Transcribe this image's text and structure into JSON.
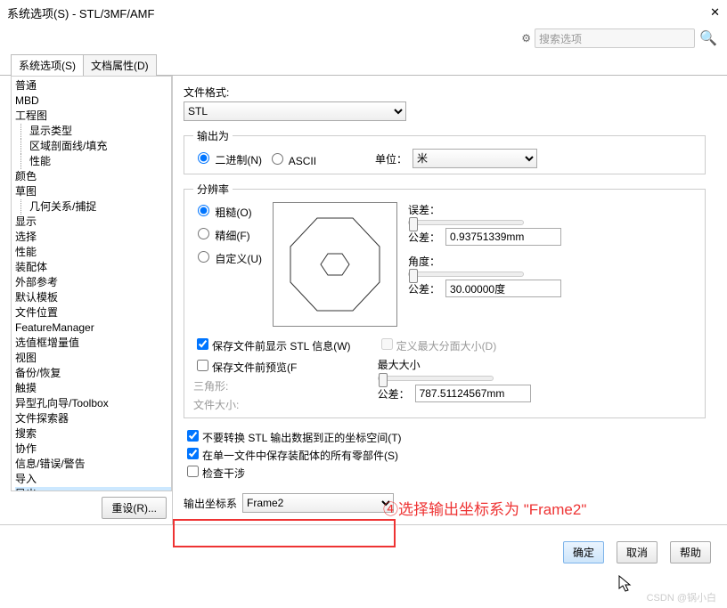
{
  "window": {
    "title": "系统选项(S) - STL/3MF/AMF"
  },
  "search": {
    "placeholder": "搜索选项"
  },
  "tabs": {
    "system": "系统选项(S)",
    "doc": "文档属性(D)"
  },
  "tree": [
    {
      "label": "普通",
      "ind": 0
    },
    {
      "label": "MBD",
      "ind": 0
    },
    {
      "label": "工程图",
      "ind": 0
    },
    {
      "label": "显示类型",
      "ind": 1
    },
    {
      "label": "区域剖面线/填充",
      "ind": 1
    },
    {
      "label": "性能",
      "ind": 1
    },
    {
      "label": "颜色",
      "ind": 0
    },
    {
      "label": "草图",
      "ind": 0
    },
    {
      "label": "几何关系/捕捉",
      "ind": 1
    },
    {
      "label": "显示",
      "ind": 0
    },
    {
      "label": "选择",
      "ind": 0
    },
    {
      "label": "性能",
      "ind": 0
    },
    {
      "label": "装配体",
      "ind": 0
    },
    {
      "label": "外部参考",
      "ind": 0
    },
    {
      "label": "默认模板",
      "ind": 0
    },
    {
      "label": "文件位置",
      "ind": 0
    },
    {
      "label": "FeatureManager",
      "ind": 0
    },
    {
      "label": "选值框增量值",
      "ind": 0
    },
    {
      "label": "视图",
      "ind": 0
    },
    {
      "label": "备份/恢复",
      "ind": 0
    },
    {
      "label": "触摸",
      "ind": 0
    },
    {
      "label": "异型孔向导/Toolbox",
      "ind": 0
    },
    {
      "label": "文件探索器",
      "ind": 0
    },
    {
      "label": "搜索",
      "ind": 0
    },
    {
      "label": "协作",
      "ind": 0
    },
    {
      "label": "信息/错误/警告",
      "ind": 0
    },
    {
      "label": "导入",
      "ind": 0
    },
    {
      "label": "导出",
      "ind": 0
    }
  ],
  "reset": "重设(R)...",
  "main": {
    "file_format_lbl": "文件格式:",
    "file_format_val": "STL",
    "output_as_lbl": "输出为",
    "binary": "二进制(N)",
    "ascii": "ASCII",
    "unit_lbl": "单位：",
    "unit_val": "米",
    "resolution_lbl": "分辨率",
    "coarse": "粗糙(O)",
    "fine": "精细(F)",
    "custom": "自定义(U)",
    "deviation_lbl": "误差：",
    "tol1_lbl": "公差：",
    "tol1_val": "0.93751339mm",
    "angle_lbl": "角度：",
    "tol2_lbl": "公差：",
    "tol2_val": "30.00000度",
    "show_stl": "保存文件前显示 STL 信息(W)",
    "define_max": "定义最大分面大小(D)",
    "preview_chk": "保存文件前预览(F",
    "triangles": "三角形:",
    "max_lbl": "最大大小",
    "filesize": "文件大小:",
    "tol3_lbl": "公差：",
    "tol3_val": "787.51124567mm",
    "no_transform": "不要转换 STL 输出数据到正的坐标空间(T)",
    "single_file": "在单一文件中保存装配体的所有零部件(S)",
    "check": "检查干涉",
    "coord_lbl": "输出坐标系",
    "coord_val": "Frame2"
  },
  "annotation": "④选择输出坐标系为 \"Frame2\"",
  "footer": {
    "ok": "确定",
    "cancel": "取消",
    "help": "帮助"
  },
  "watermark": "CSDN @锅小白"
}
